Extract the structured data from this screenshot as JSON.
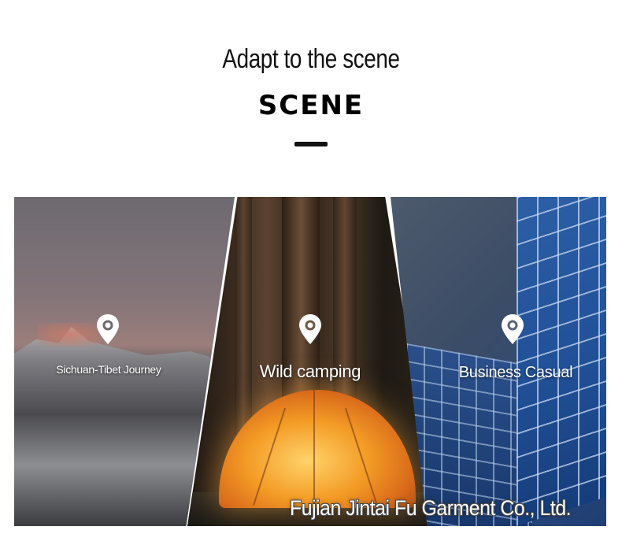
{
  "header": {
    "subtitle": "Adapt to the scene",
    "title": "SCENE"
  },
  "scenes": [
    {
      "label": "Sichuan-Tibet Journey",
      "icon": "location-pin-icon"
    },
    {
      "label": "Wild camping",
      "icon": "location-pin-icon"
    },
    {
      "label": "Business Casual",
      "icon": "location-pin-icon"
    }
  ],
  "watermark": "Fujian Jintai Fu Garment Co., Ltd.",
  "colors": {
    "background": "#ffffff",
    "title_text": "#000000",
    "label_text": "#ffffff"
  }
}
